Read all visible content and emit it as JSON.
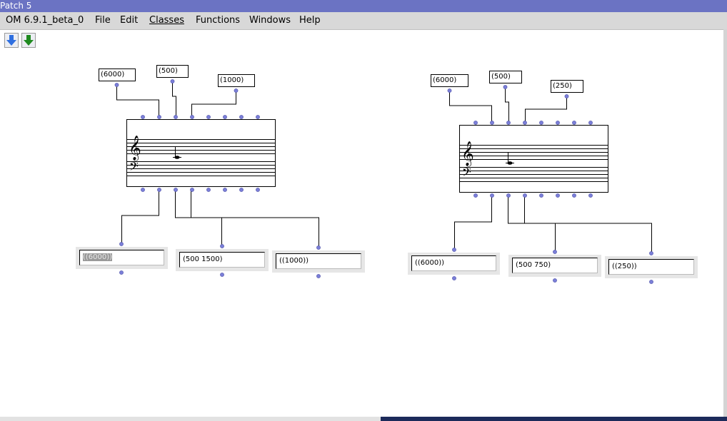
{
  "window": {
    "title": "Patch 5"
  },
  "menubar": {
    "items": [
      "OM 6.9.1_beta_0",
      "File",
      "Edit",
      "Classes",
      "Functions",
      "Windows",
      "Help"
    ]
  },
  "toolbar": {
    "buttons": [
      "arrow-down-blue-icon",
      "arrow-down-green-icon"
    ]
  },
  "patches": [
    {
      "inputs": [
        "(6000)",
        "(500)",
        "(1000)"
      ],
      "outputs": [
        "((6000))",
        "(500 1500)",
        "((1000))"
      ]
    },
    {
      "inputs": [
        "(6000)",
        "(500)",
        "(250)"
      ],
      "outputs": [
        "((6000))",
        "(500 750)",
        "((250))"
      ]
    }
  ],
  "colors": {
    "titlebar": "#6b73c3",
    "menubar": "#d8d8d8",
    "outlet": "#7b7fd8"
  }
}
